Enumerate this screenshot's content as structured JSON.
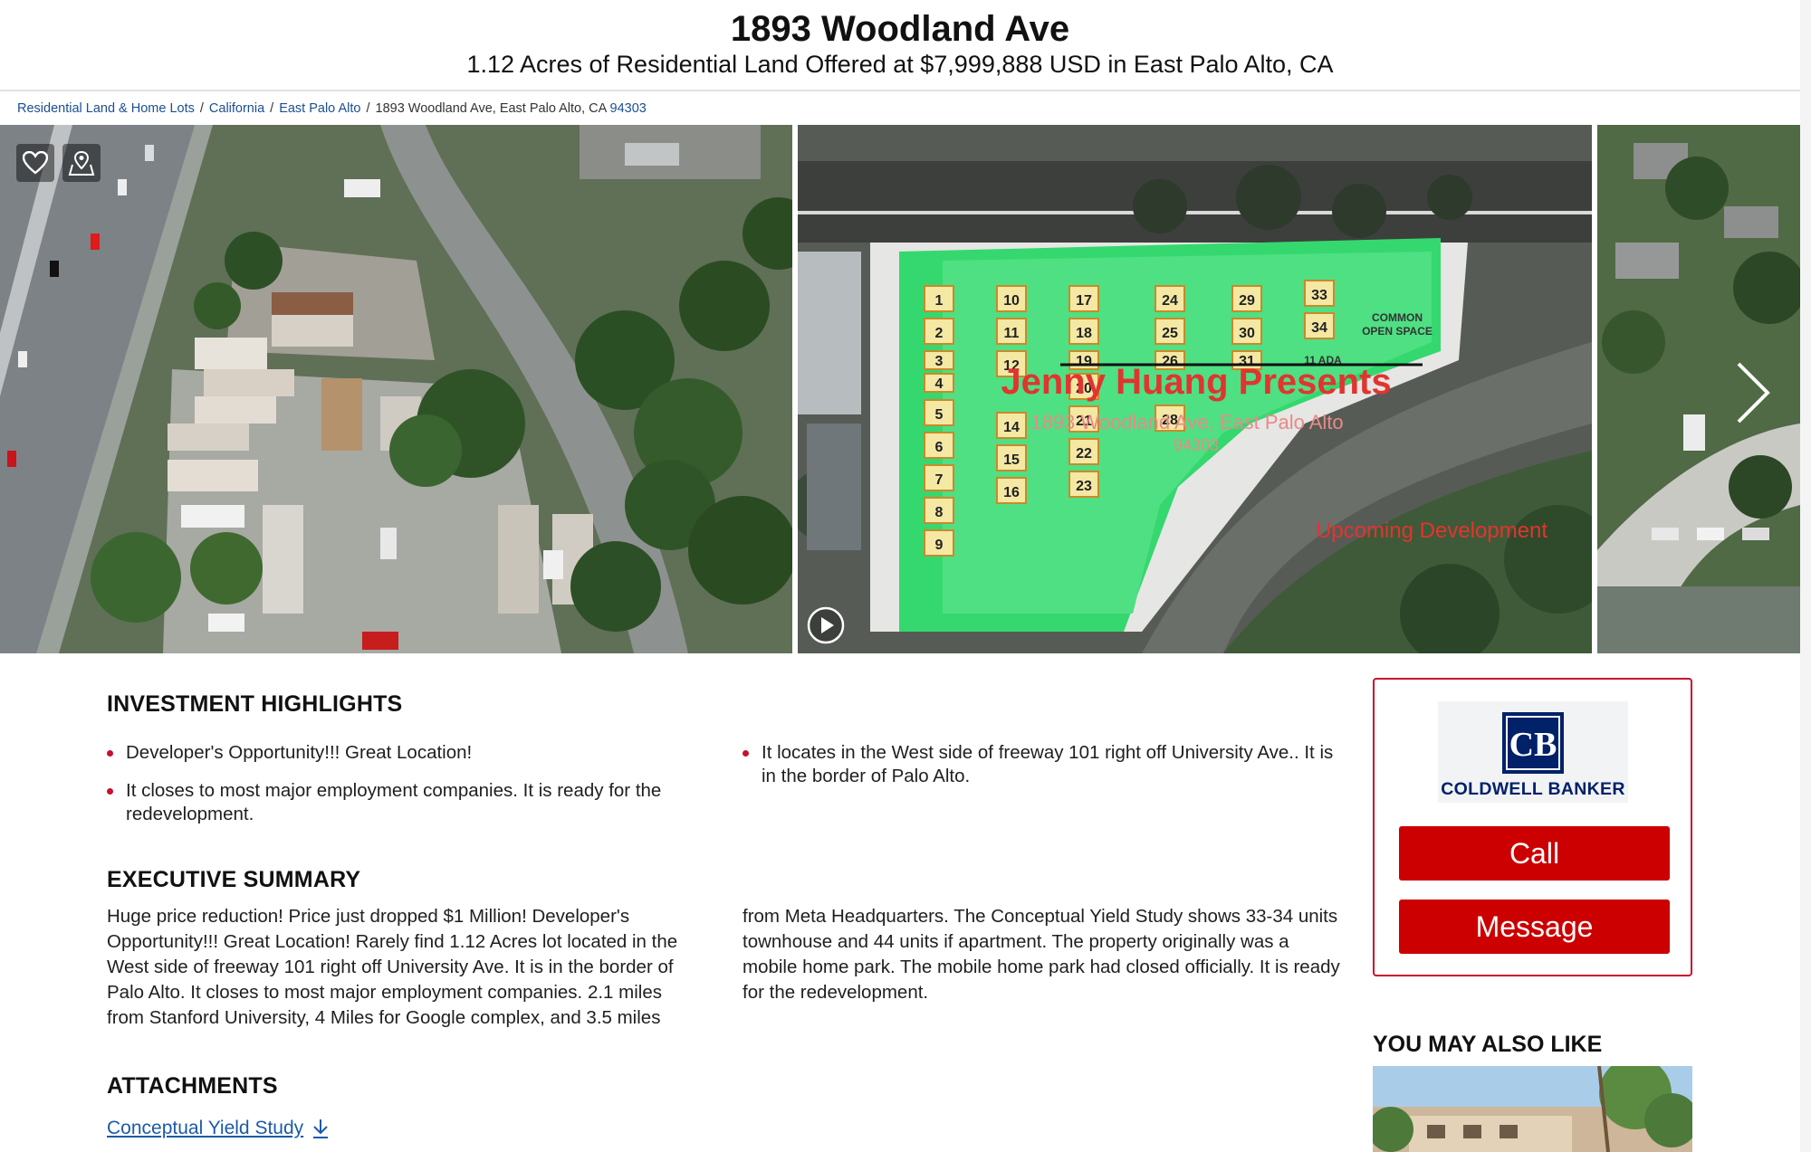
{
  "listing": {
    "title": "1893 Woodland Ave",
    "subtitle": "1.12 Acres of Residential Land Offered at $7,999,888 USD in East Palo Alto, CA"
  },
  "breadcrumb": {
    "items": [
      "Residential Land & Home Lots",
      "California",
      "East Palo Alto"
    ],
    "current": "1893 Woodland Ave, East Palo Alto, CA",
    "zip": "94303"
  },
  "gallery": {
    "icons": [
      "heart-icon",
      "map-pin-icon",
      "play-icon",
      "chevron-right-icon"
    ],
    "site_plan": {
      "overlay_title": "Jenny Huang Presents",
      "overlay_address": "1893 Woodland Ave, East Palo Alto",
      "overlay_zip": "94303",
      "overlay_footer": "Upcoming Development",
      "common_space_line1": "COMMON",
      "common_space_line2": "OPEN SPACE",
      "ada_label": "11 ADA",
      "lots": [
        "1",
        "2",
        "3",
        "4",
        "5",
        "6",
        "7",
        "8",
        "9",
        "10",
        "11",
        "12",
        "14",
        "15",
        "16",
        "17",
        "18",
        "19",
        "20",
        "21",
        "22",
        "23",
        "24",
        "25",
        "26",
        "28",
        "29",
        "30",
        "31",
        "33",
        "34"
      ]
    }
  },
  "highlights": {
    "heading": "INVESTMENT HIGHLIGHTS",
    "left": [
      "Developer's Opportunity!!! Great Location!",
      "It closes to most major employment companies. It is ready for the redevelopment."
    ],
    "right": [
      "It locates in the West side of freeway 101 right off University Ave.. It is in the border of Palo Alto."
    ]
  },
  "summary": {
    "heading": "EXECUTIVE SUMMARY",
    "col1": "Huge price reduction! Price just dropped $1 Million! Developer's Opportunity!!! Great Location! Rarely find 1.12 Acres lot located in the West side of freeway 101 right off University Ave. It is in the border of Palo Alto. It closes to most major employment companies. 2.1 miles from Stanford University, 4 Miles for Google complex, and 3.5 miles",
    "col2": "from Meta Headquarters. The Conceptual Yield Study shows 33-34 units townhouse and 44 units if apartment. The property originally was a mobile home park. The mobile home park had closed officially. It is ready for the redevelopment."
  },
  "attachments": {
    "heading": "ATTACHMENTS",
    "items": [
      {
        "label": "Conceptual Yield Study",
        "icon": "download-icon"
      }
    ]
  },
  "agent": {
    "logo_text": "COLDWELL BANKER",
    "call_label": "Call",
    "message_label": "Message",
    "brand_color": "#012169",
    "accent_color": "#cc0000"
  },
  "also_like": {
    "heading": "YOU MAY ALSO LIKE"
  }
}
